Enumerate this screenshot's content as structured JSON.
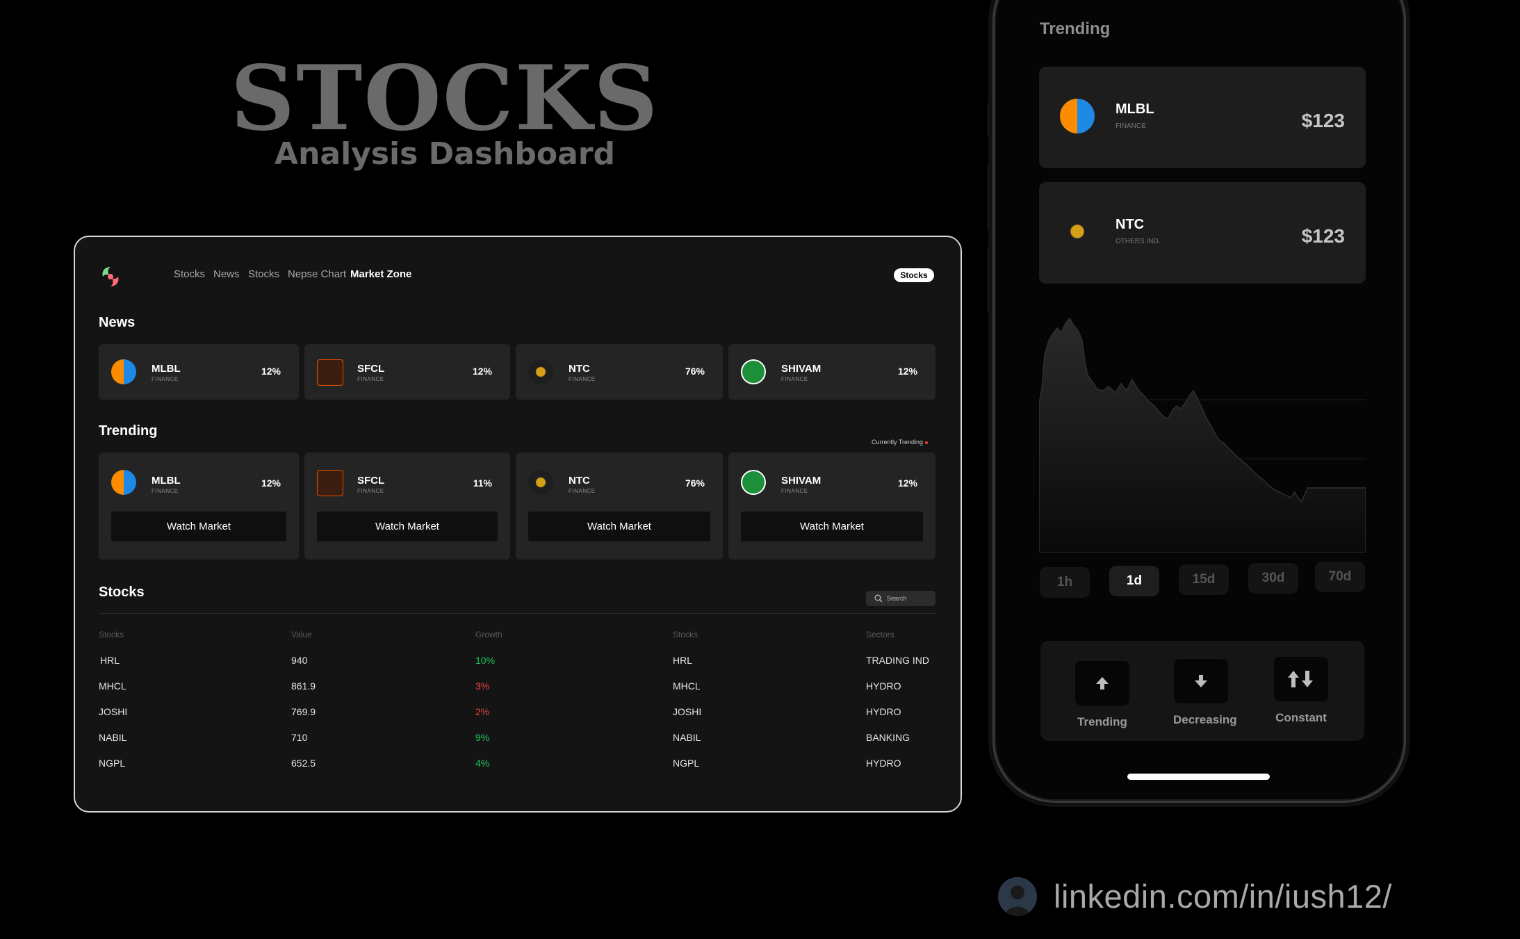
{
  "hero": {
    "title": "STOCKS",
    "subtitle": "Analysis Dashboard"
  },
  "nav": {
    "items": [
      "Stocks",
      "News",
      "Stocks",
      "Nepse Chart",
      "Market Zone"
    ],
    "active": "Market Zone",
    "pill": "Stocks"
  },
  "news": {
    "title": "News",
    "cards": [
      {
        "name": "MLBL",
        "sector": "FINANCE",
        "pct": "12%",
        "logo_color": "#1e88e5"
      },
      {
        "name": "SFCL",
        "sector": "FINANCE",
        "pct": "12%",
        "logo_color": "#e65100"
      },
      {
        "name": "NTC",
        "sector": "FINANCE",
        "pct": "76%",
        "logo_color": "#d4a017"
      },
      {
        "name": "SHIVAM",
        "sector": "FINANCE",
        "pct": "12%",
        "logo_color": "#1b8f3a"
      }
    ]
  },
  "trending": {
    "title": "Trending",
    "badge": "Currently Trending",
    "button_label": "Watch Market",
    "cards": [
      {
        "name": "MLBL",
        "sector": "FINANCE",
        "pct": "12%"
      },
      {
        "name": "SFCL",
        "sector": "FINANCE",
        "pct": "11%"
      },
      {
        "name": "NTC",
        "sector": "FINANCE",
        "pct": "76%"
      },
      {
        "name": "SHIVAM",
        "sector": "FINANCE",
        "pct": "12%"
      }
    ]
  },
  "stocks": {
    "title": "Stocks",
    "search_placeholder": "Search",
    "headers": [
      "Stocks",
      "Value",
      "Growth",
      "Stocks",
      "Sectors"
    ],
    "rows": [
      {
        "stock": "HRL",
        "value": "940",
        "growth": "10%",
        "trend": "up",
        "stock2": "HRL",
        "sector": "TRADING IND"
      },
      {
        "stock": "MHCL",
        "value": "861.9",
        "growth": "3%",
        "trend": "down",
        "stock2": "MHCL",
        "sector": "HYDRO"
      },
      {
        "stock": "JOSHI",
        "value": "769.9",
        "growth": "2%",
        "trend": "down",
        "stock2": "JOSHI",
        "sector": "HYDRO"
      },
      {
        "stock": "NABIL",
        "value": "710",
        "growth": "9%",
        "trend": "up",
        "stock2": "NABIL",
        "sector": "BANKING"
      },
      {
        "stock": "NGPL",
        "value": "652.5",
        "growth": "4%",
        "trend": "up",
        "stock2": "NGPL",
        "sector": "HYDRO"
      }
    ]
  },
  "phone": {
    "title": "Trending",
    "cards": [
      {
        "name": "MLBL",
        "sector": "FINANCE",
        "price": "$123"
      },
      {
        "name": "NTC",
        "sector": "OTHERS IND.",
        "price": "$123"
      }
    ],
    "timeframes": [
      "1h",
      "1d",
      "15d",
      "30d",
      "70d"
    ],
    "active_timeframe": "1d",
    "actions": [
      {
        "label": "Trending",
        "icon": "arrow-up-icon"
      },
      {
        "label": "Decreasing",
        "icon": "arrow-down-icon"
      },
      {
        "label": "Constant",
        "icon": "arrows-updown-icon"
      }
    ]
  },
  "footer": {
    "linkedin": "linkedin.com/in/iush12/"
  },
  "colors": {
    "up": "#22c55e",
    "down": "#ef4444",
    "background": "#000000",
    "card": "#242424"
  }
}
